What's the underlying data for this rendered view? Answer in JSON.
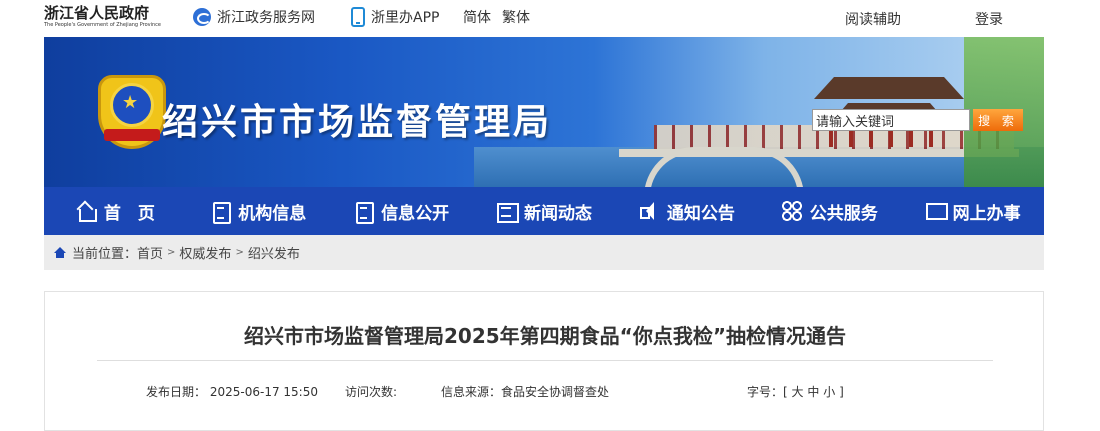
{
  "topbar": {
    "gov_name": "浙江省人民政府",
    "gov_name_en": "The People's Government of Zhejiang Province",
    "links": [
      {
        "label": "浙江政务服务网",
        "icon": "service-network-icon"
      },
      {
        "label": "浙里办APP",
        "icon": "phone-icon"
      }
    ],
    "lang_simplified": "简体",
    "lang_traditional": "繁体",
    "reading_aid": "阅读辅助",
    "login": "登录"
  },
  "banner": {
    "agency_title": "绍兴市市场监督管理局",
    "search_placeholder": "请输入关键词",
    "search_button": "搜 索"
  },
  "nav": {
    "items": [
      {
        "label": "首　页",
        "icon": "home-icon"
      },
      {
        "label": "机构信息",
        "icon": "document-icon"
      },
      {
        "label": "信息公开",
        "icon": "document-list-icon"
      },
      {
        "label": "新闻动态",
        "icon": "newspaper-icon"
      },
      {
        "label": "通知公告",
        "icon": "speaker-icon"
      },
      {
        "label": "公共服务",
        "icon": "grid-icon"
      },
      {
        "label": "网上办事",
        "icon": "monitor-icon"
      }
    ]
  },
  "breadcrumb": {
    "prefix": "当前位置：",
    "items": [
      "首页",
      "权威发布",
      "绍兴发布"
    ],
    "separator": ">"
  },
  "article": {
    "title": "绍兴市市场监督管理局2025年第四期食品“你点我检”抽检情况通告",
    "publish_label": "发布日期：",
    "publish_date": "2025-06-17 15:50",
    "visits_label": "访问次数:",
    "source_label": "信息来源：",
    "source": "食品安全协调督查处",
    "font_size_label": "字号：",
    "font_size_open": "[",
    "font_sizes": [
      "大",
      "中",
      "小"
    ],
    "font_size_close": "]"
  },
  "colors": {
    "nav_bg": "#1b47b5",
    "search_button": "#ee6b0a",
    "breadcrumb_bg": "#ececec"
  }
}
